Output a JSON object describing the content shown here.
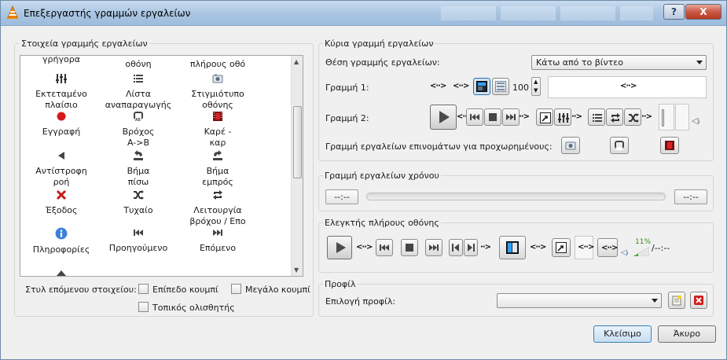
{
  "window": {
    "title": "Επεξεργαστής γραμμών εργαλείων",
    "help_label": "?",
    "close_label": "X",
    "accent": "#3c7fb1"
  },
  "palette": {
    "group_label": "Στοιχεία γραμμής εργαλείων",
    "items": [
      {
        "label": "γρήγορα",
        "icon": "fast-icon"
      },
      {
        "label": "οθόνη",
        "icon": "screen-icon"
      },
      {
        "label": "πλήρους οθό",
        "icon": "fullscreen-icon"
      },
      {
        "label": "Εκτεταμένο πλαίσιο",
        "icon": "equalizer-icon"
      },
      {
        "label": "Λίστα αναπαραγωγής",
        "icon": "playlist-icon"
      },
      {
        "label": "Στιγμιότυπο οθόνης",
        "icon": "snapshot-icon"
      },
      {
        "label": "Εγγραφή",
        "icon": "record-icon"
      },
      {
        "label": "Βρόχος A->B",
        "icon": "loop-ab-icon"
      },
      {
        "label": "Καρέ - καρ",
        "icon": "frame-icon"
      },
      {
        "label": "Αντίστροφη ροή",
        "icon": "reverse-icon"
      },
      {
        "label": "Βήμα πίσω",
        "icon": "step-back-icon"
      },
      {
        "label": "Βήμα εμπρός",
        "icon": "step-forward-icon"
      },
      {
        "label": "Έξοδος",
        "icon": "exit-icon"
      },
      {
        "label": "Τυχαίο",
        "icon": "shuffle-icon"
      },
      {
        "label": "Λειτουργία βρόχου / Επο",
        "icon": "repeat-icon"
      },
      {
        "label": "Πληροφορίες",
        "icon": "info-icon"
      },
      {
        "label": "Προηγούμενο",
        "icon": "previous-icon"
      },
      {
        "label": "Επόμενο",
        "icon": "next-icon"
      }
    ],
    "style_label": "Στυλ επόμενου στοιχείου:",
    "flat_button": "Επίπεδο κουμπί",
    "big_button": "Μεγάλο κουμπί",
    "native_slider": "Τοπικός ολισθητής"
  },
  "main_toolbar": {
    "group_label": "Κύρια γραμμή εργαλείων",
    "position_label": "Θέση γραμμής εργαλείων:",
    "position_value": "Κάτω από το βίντεο",
    "line1_label": "Γραμμή 1:",
    "volume_value": "100",
    "line2_label": "Γραμμή 2:",
    "advanced_label": "Γραμμή εργαλείων επινομάτων για προχωρημένους:"
  },
  "time_toolbar": {
    "group_label": "Γραμμή εργαλείων χρόνου",
    "elapsed": "--:--",
    "remaining": "--:--"
  },
  "fullscreen_controller": {
    "group_label": "Ελεγκτής πλήρους οθόνης",
    "volume_percent": "11%",
    "time": "/--:--"
  },
  "profile": {
    "group_label": "Προφίλ",
    "select_label": "Επιλογή προφίλ:",
    "value": ""
  },
  "buttons": {
    "close": "Κλείσιμο",
    "cancel": "Άκυρο"
  }
}
